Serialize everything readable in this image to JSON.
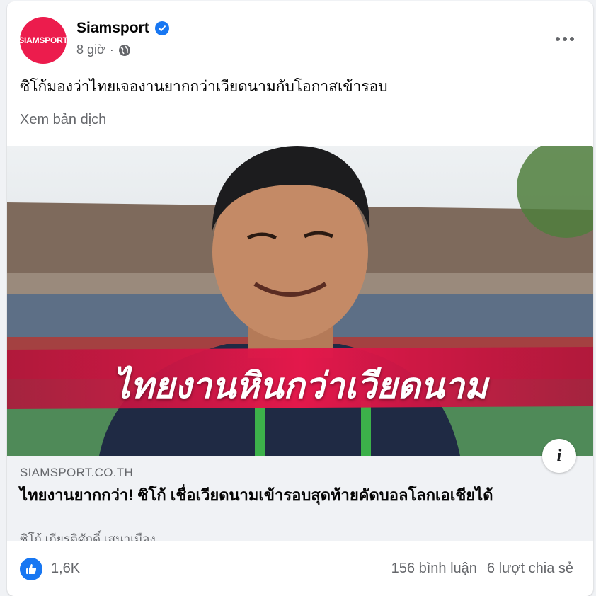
{
  "post": {
    "page_name": "Siamsport",
    "avatar_text": "SIAMSPORT",
    "time": "8 giờ",
    "separator": "·",
    "text": "ซิโก้มองว่าไทยเจองานยากกว่าเวียดนามกับโอกาสเข้ารอบ",
    "see_translation": "Xem bản dịch"
  },
  "media": {
    "headline_overlay": "ไทยงานหินกว่าเวียดนาม",
    "info_icon": "i"
  },
  "link_preview": {
    "domain": "SIAMSPORT.CO.TH",
    "title": "ไทยงานยากกว่า! ซิโก้ เชื่อเวียดนามเข้ารอบสุดท้ายคัดบอลโลกเอเชียได้",
    "description": "ซิโก้ เกียรติศักดิ์ เสนาเมือง ..."
  },
  "stats": {
    "reaction_count": "1,6K",
    "comments": "156 bình luận",
    "shares": "6 lượt chia sẻ"
  },
  "colors": {
    "brand": "#ec1c4d",
    "facebook_blue": "#1877f2",
    "secondary_text": "#65676b"
  },
  "icons": [
    "verified-badge-icon",
    "globe-icon",
    "more-options-icon",
    "info-icon",
    "like-icon"
  ]
}
